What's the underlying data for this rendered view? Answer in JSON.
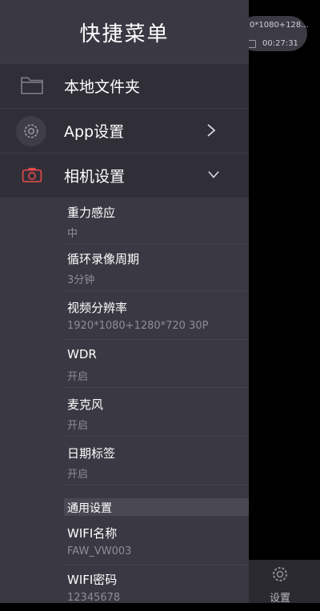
{
  "background": {
    "status_line1": "0*1080+128...",
    "status_line2": "00:27:31",
    "bottom_tab_label": "设置"
  },
  "drawer": {
    "title": "快捷菜单",
    "menu": [
      {
        "label": "本地文件夹",
        "icon": "folder-icon"
      },
      {
        "label": "App设置",
        "icon": "gear-icon",
        "chevron": "chevron-right-icon"
      },
      {
        "label": "相机设置",
        "icon": "camera-icon",
        "chevron": "chevron-down-icon"
      }
    ],
    "camera_settings": [
      {
        "name": "重力感应",
        "value": "中"
      },
      {
        "name": "循环录像周期",
        "value": "3分钟"
      },
      {
        "name": "视频分辨率",
        "value": "1920*1080+1280*720 30P"
      },
      {
        "name": "WDR",
        "value": "开启"
      },
      {
        "name": "麦克风",
        "value": "开启"
      },
      {
        "name": "日期标签",
        "value": "开启"
      }
    ],
    "general_section_title": "通用设置",
    "general_settings": [
      {
        "name": "WIFI名称",
        "value": "FAW_VW003"
      },
      {
        "name": "WIFI密码",
        "value": "12345678"
      }
    ]
  },
  "colors": {
    "drawer_bg": "#3a3943",
    "menu_row_bg": "#302f38",
    "camera_icon": "#e0474c"
  }
}
